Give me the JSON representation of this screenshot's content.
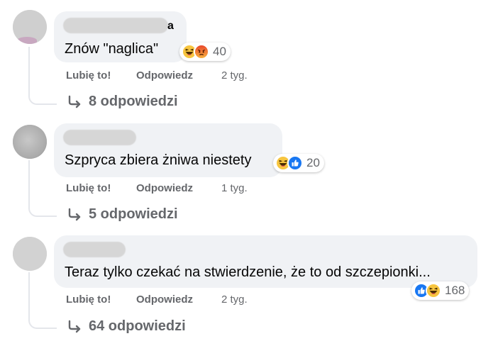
{
  "comments": [
    {
      "author_visible_suffix": "a",
      "text": "Znów \"naglica\"",
      "reactions": [
        "haha-icon",
        "angry-icon"
      ],
      "reaction_count": "40",
      "like_label": "Lubię to!",
      "reply_label": "Odpowiedz",
      "time": "2 tyg.",
      "replies_label": "8 odpowiedzi"
    },
    {
      "author_visible_suffix": "",
      "text": "Szpryca zbiera żniwa niestety",
      "reactions": [
        "haha-icon",
        "like-icon"
      ],
      "reaction_count": "20",
      "like_label": "Lubię to!",
      "reply_label": "Odpowiedz",
      "time": "1 tyg.",
      "replies_label": "5 odpowiedzi"
    },
    {
      "author_visible_suffix": "",
      "text": "Teraz tylko czekać na stwierdzenie, że to od szczepionki...",
      "reactions": [
        "like-icon",
        "haha-icon"
      ],
      "reaction_count": "168",
      "like_label": "Lubię to!",
      "reply_label": "Odpowiedz",
      "time": "2 tyg.",
      "replies_label": "64 odpowiedzi"
    }
  ],
  "colors": {
    "bubble": "#f0f2f5",
    "meta_text": "#65676b",
    "like_blue": "#1877f2",
    "haha_yellow": "#f7c53f",
    "angry_red": "#e9710f"
  }
}
